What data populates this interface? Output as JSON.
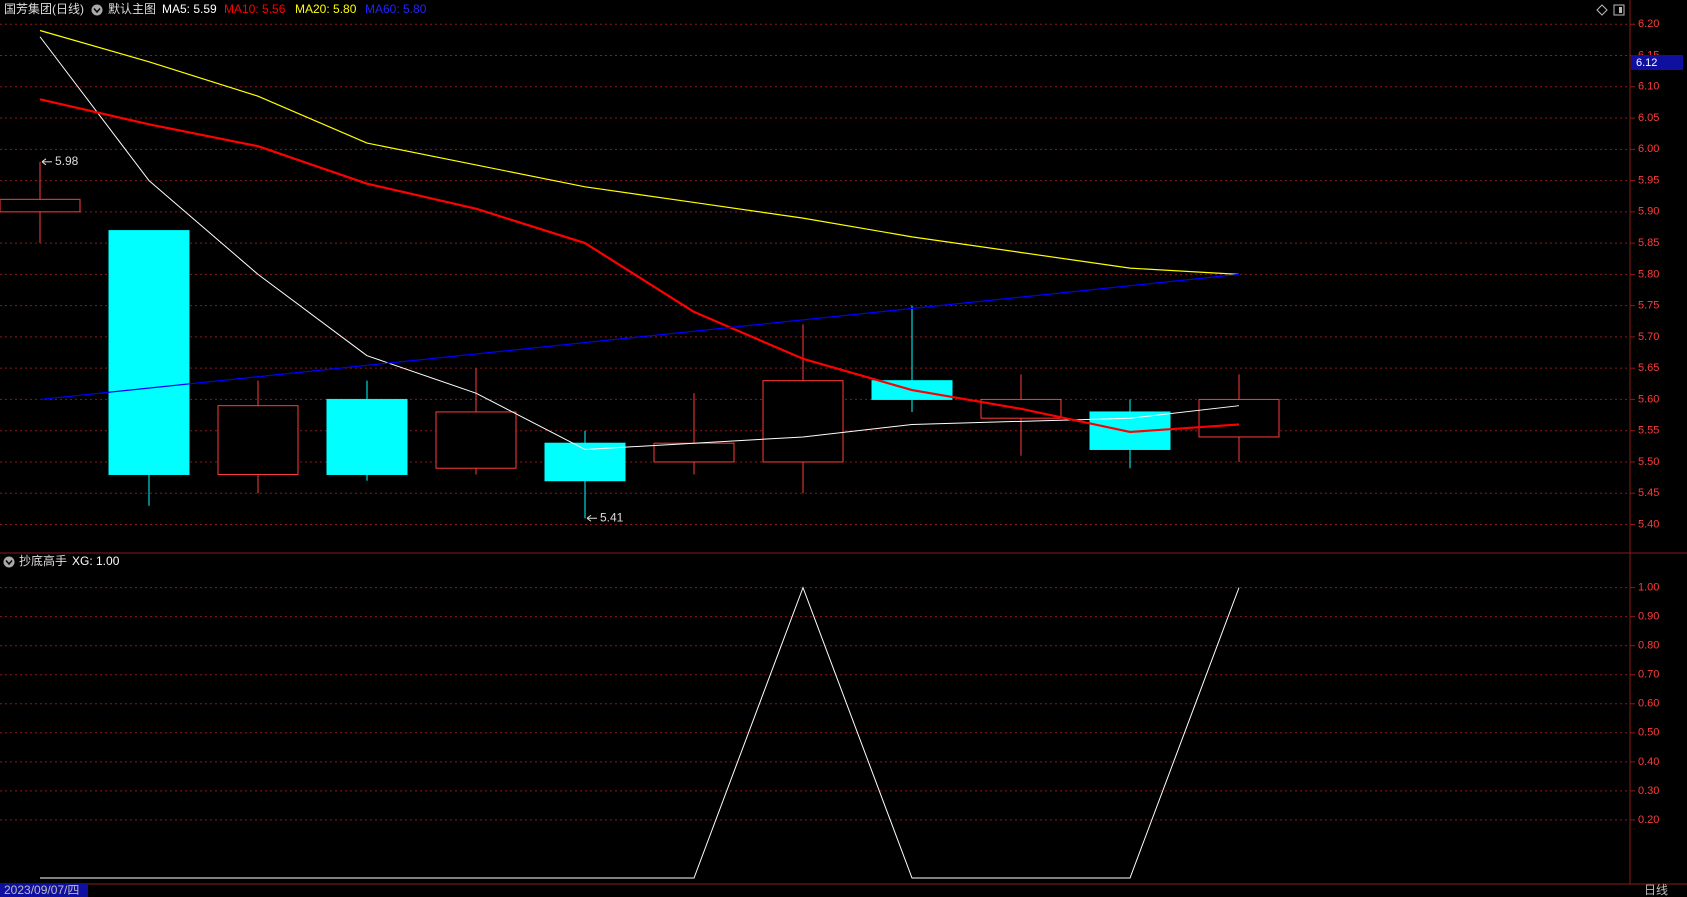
{
  "title": {
    "security": "国芳集团(日线)",
    "main_chart_label": "默认主图",
    "indicator_name": "抄底高手"
  },
  "header": {
    "ma5": "MA5: 5.59",
    "ma10": "MA10: 5.56",
    "ma20": "MA20: 5.80",
    "ma60": "MA60: 5.80",
    "xg": "XG: 1.00"
  },
  "footer": {
    "date": "2023/09/07/四",
    "period": "日线"
  },
  "colors": {
    "background": "#000000",
    "grid": "#8b1a1a",
    "axis_text": "#ff3b3b",
    "up": "#ff3b3b",
    "down": "#00ffff",
    "ma5": "#ffffff",
    "ma10": "#ff0000",
    "ma20": "#ffff00",
    "ma60": "#0000ff",
    "current_price_box": "#1010a0"
  },
  "icons": {
    "collapse_main": "chevron-down-icon",
    "collapse_indicator": "chevron-down-icon",
    "diamond": "diamond-icon",
    "window": "square-icon"
  },
  "chart_data": [
    {
      "type": "candlestick",
      "title": "国芳集团(日线)",
      "ylim": [
        5.38,
        6.21
      ],
      "y_ticks": [
        6.2,
        6.15,
        6.1,
        6.05,
        6.0,
        5.95,
        5.9,
        5.85,
        5.8,
        5.75,
        5.7,
        5.65,
        5.6,
        5.55,
        5.5,
        5.45,
        5.4
      ],
      "y_tick_labels": [
        "6.20",
        "6.15",
        "6.10",
        "6.05",
        "6.00",
        "5.95",
        "5.90",
        "5.85",
        "5.80",
        "5.75",
        "5.70",
        "5.65",
        "5.60",
        "5.55",
        "5.50",
        "5.45",
        "5.40"
      ],
      "grid": true,
      "current_price": 6.12,
      "current_price_label": "6.12",
      "candles": [
        {
          "open": 5.9,
          "high": 5.98,
          "low": 5.85,
          "close": 5.92
        },
        {
          "open": 5.87,
          "high": 5.87,
          "low": 5.43,
          "close": 5.48
        },
        {
          "open": 5.48,
          "high": 5.63,
          "low": 5.45,
          "close": 5.59
        },
        {
          "open": 5.6,
          "high": 5.63,
          "low": 5.47,
          "close": 5.48
        },
        {
          "open": 5.49,
          "high": 5.65,
          "low": 5.48,
          "close": 5.58
        },
        {
          "open": 5.53,
          "high": 5.55,
          "low": 5.41,
          "close": 5.47
        },
        {
          "open": 5.5,
          "high": 5.61,
          "low": 5.48,
          "close": 5.53
        },
        {
          "open": 5.5,
          "high": 5.72,
          "low": 5.45,
          "close": 5.63
        },
        {
          "open": 5.63,
          "high": 5.75,
          "low": 5.58,
          "close": 5.6
        },
        {
          "open": 5.57,
          "high": 5.64,
          "low": 5.51,
          "close": 5.6
        },
        {
          "open": 5.58,
          "high": 5.6,
          "low": 5.49,
          "close": 5.52
        },
        {
          "open": 5.54,
          "high": 5.64,
          "low": 5.5,
          "close": 5.6
        }
      ],
      "series": [
        {
          "name": "MA5",
          "values": [
            6.18,
            5.95,
            5.8,
            5.67,
            5.61,
            5.52,
            5.53,
            5.54,
            5.56,
            5.565,
            5.57,
            5.59
          ]
        },
        {
          "name": "MA10",
          "values": [
            6.08,
            6.04,
            6.005,
            5.945,
            5.905,
            5.85,
            5.74,
            5.665,
            5.615,
            5.585,
            5.548,
            5.56
          ]
        },
        {
          "name": "MA20",
          "values": [
            6.19,
            6.14,
            6.085,
            6.01,
            5.975,
            5.94,
            5.915,
            5.89,
            5.86,
            5.835,
            5.81,
            5.8
          ]
        },
        {
          "name": "MA60",
          "values": [
            5.6,
            null,
            null,
            null,
            null,
            null,
            null,
            null,
            null,
            null,
            null,
            5.8
          ]
        }
      ],
      "annotations": [
        {
          "label": "5.98",
          "candle": 0,
          "price": 5.98
        },
        {
          "label": "5.41",
          "candle": 5,
          "price": 5.41
        }
      ]
    },
    {
      "type": "line",
      "title": "抄底高手",
      "ylim": [
        0.0,
        1.04
      ],
      "y_ticks": [
        1.0,
        0.9,
        0.8,
        0.7,
        0.6,
        0.5,
        0.4,
        0.3,
        0.2
      ],
      "y_tick_labels": [
        "1.00",
        "0.90",
        "0.80",
        "0.70",
        "0.60",
        "0.50",
        "0.40",
        "0.30",
        "0.20"
      ],
      "grid": true,
      "series": [
        {
          "name": "XG",
          "values": [
            0,
            0,
            0,
            0,
            0,
            0,
            0,
            1,
            0,
            0,
            0,
            1
          ]
        }
      ]
    }
  ]
}
